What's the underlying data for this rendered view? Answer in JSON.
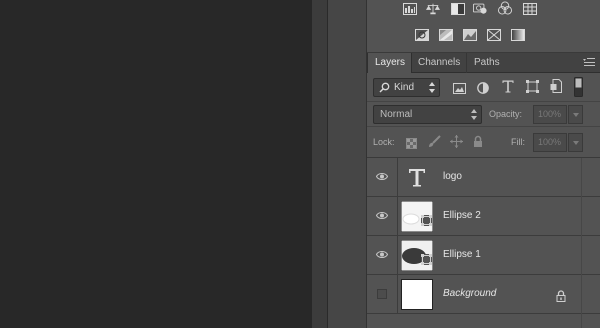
{
  "tabs": [
    {
      "label": "Layers",
      "active": true
    },
    {
      "label": "Channels",
      "active": false
    },
    {
      "label": "Paths",
      "active": false
    }
  ],
  "filter": {
    "label": "Kind"
  },
  "blend": {
    "mode": "Normal",
    "opacity_label": "Opacity:",
    "opacity_value": "100%"
  },
  "lock": {
    "label": "Lock:",
    "fill_label": "Fill:",
    "fill_value": "100%"
  },
  "layers": [
    {
      "name": "logo",
      "type": "text",
      "visible": true
    },
    {
      "name": "Ellipse 2",
      "type": "shape",
      "visible": true
    },
    {
      "name": "Ellipse 1",
      "type": "shape",
      "visible": true
    },
    {
      "name": "Background",
      "type": "background",
      "visible": false,
      "locked": true
    }
  ],
  "adjustment_icons": [
    "levels-icon",
    "balance-icon",
    "black-white-icon",
    "photo-filter-icon",
    "channel-mixer-icon",
    "color-lookup-icon",
    "invert-icon",
    "posterize-icon",
    "threshold-icon",
    "selective-color-icon",
    "gradient-map-icon"
  ],
  "colors": {
    "panel": "#535353",
    "canvas": "#282828",
    "tabbar": "#424242"
  }
}
